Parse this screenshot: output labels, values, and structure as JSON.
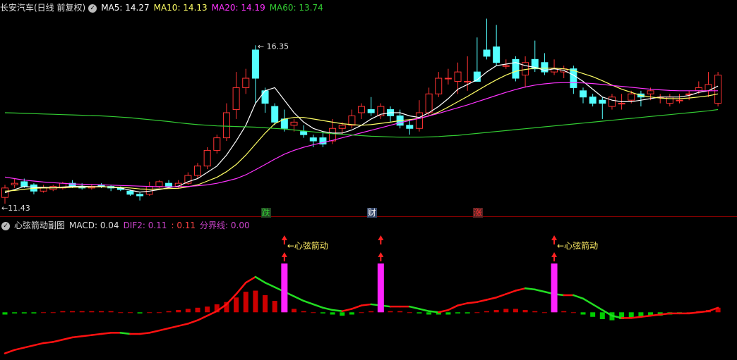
{
  "header": {
    "title": "长安汽车(日线 前复权)",
    "ma": [
      {
        "label": "MA5: 14.27",
        "color": "#ffffff"
      },
      {
        "label": "MA10: 14.13",
        "color": "#ffff66"
      },
      {
        "label": "MA20: 14.19",
        "color": "#ff33ff"
      },
      {
        "label": "MA60: 13.74",
        "color": "#33cc33"
      }
    ]
  },
  "sub_header": {
    "title": "心弦箭动副图",
    "items": [
      {
        "label": "MACD: 0.04",
        "color": "#dddddd"
      },
      {
        "label": "DIF2: 0.11",
        "color": "#cc44cc"
      },
      {
        "label": ": 0.11",
        "color": "#ff4444"
      },
      {
        "label": "分界线: 0.00",
        "color": "#cc44cc"
      }
    ]
  },
  "price_labels": {
    "high": "16.35",
    "low": "11.43"
  },
  "tags": [
    {
      "text": "跌",
      "index": 27,
      "color": "#33cc33"
    },
    {
      "text": "财",
      "index": 38,
      "color": "#ffffff"
    },
    {
      "text": "涨",
      "index": 49,
      "color": "#ff3333"
    }
  ],
  "signal_label": "←心弦箭动",
  "chart_data": [
    {
      "type": "candlestick",
      "title": "长安汽车(日线 前复权)",
      "ylim": [
        11.1,
        17.3
      ],
      "candles": [
        [
          11.5,
          11.8,
          11.9,
          11.3
        ],
        [
          11.9,
          11.95,
          12.1,
          11.8
        ],
        [
          12.0,
          11.85,
          12.1,
          11.8
        ],
        [
          11.9,
          11.7,
          11.95,
          11.6
        ],
        [
          11.7,
          11.8,
          11.9,
          11.65
        ],
        [
          11.75,
          11.85,
          11.9,
          11.7
        ],
        [
          11.8,
          11.95,
          12.0,
          11.75
        ],
        [
          11.95,
          11.85,
          12.05,
          11.8
        ],
        [
          11.85,
          11.8,
          11.95,
          11.75
        ],
        [
          11.8,
          11.85,
          11.9,
          11.75
        ],
        [
          11.9,
          11.85,
          11.95,
          11.8
        ],
        [
          11.85,
          11.8,
          11.9,
          11.7
        ],
        [
          11.8,
          11.75,
          11.85,
          11.7
        ],
        [
          11.7,
          11.6,
          11.75,
          11.55
        ],
        [
          11.6,
          11.55,
          11.65,
          11.4
        ],
        [
          11.6,
          11.85,
          12.0,
          11.55
        ],
        [
          11.85,
          12.0,
          12.05,
          11.8
        ],
        [
          11.95,
          11.85,
          12.05,
          11.8
        ],
        [
          11.85,
          11.95,
          12.05,
          11.8
        ],
        [
          11.95,
          12.2,
          12.3,
          11.9
        ],
        [
          12.2,
          12.5,
          12.6,
          12.1
        ],
        [
          12.5,
          13.0,
          13.1,
          12.4
        ],
        [
          13.0,
          13.4,
          13.5,
          12.9
        ],
        [
          13.4,
          14.2,
          14.5,
          13.3
        ],
        [
          14.3,
          15.0,
          15.5,
          14.0
        ],
        [
          15.0,
          15.3,
          15.6,
          14.8
        ],
        [
          16.2,
          15.3,
          16.35,
          14.5
        ],
        [
          14.9,
          14.5,
          15.0,
          14.2
        ],
        [
          14.4,
          13.9,
          14.5,
          13.8
        ],
        [
          14.0,
          13.7,
          14.3,
          13.6
        ],
        [
          13.8,
          13.9,
          14.0,
          13.6
        ],
        [
          13.6,
          13.5,
          13.8,
          13.4
        ],
        [
          13.4,
          13.3,
          13.5,
          13.1
        ],
        [
          13.4,
          13.2,
          13.6,
          13.1
        ],
        [
          13.3,
          13.7,
          14.0,
          13.2
        ],
        [
          13.7,
          13.8,
          13.9,
          13.5
        ],
        [
          13.8,
          14.1,
          14.3,
          13.7
        ],
        [
          14.2,
          14.4,
          14.5,
          14.0
        ],
        [
          14.3,
          14.2,
          14.7,
          14.1
        ],
        [
          14.1,
          14.4,
          14.5,
          14.0
        ],
        [
          14.3,
          14.1,
          14.4,
          13.9
        ],
        [
          14.1,
          13.8,
          14.3,
          13.7
        ],
        [
          13.8,
          13.7,
          14.0,
          13.5
        ],
        [
          13.7,
          14.2,
          14.6,
          13.6
        ],
        [
          14.2,
          14.8,
          15.0,
          14.1
        ],
        [
          14.8,
          15.3,
          15.5,
          14.7
        ],
        [
          15.3,
          15.3,
          15.6,
          15.1
        ],
        [
          15.2,
          15.5,
          15.8,
          14.8
        ],
        [
          15.2,
          15.2,
          16.0,
          14.9
        ],
        [
          15.5,
          15.2,
          16.6,
          15.3
        ],
        [
          16.2,
          16.0,
          17.2,
          15.9
        ],
        [
          16.3,
          15.8,
          17.0,
          15.7
        ],
        [
          15.7,
          15.7,
          15.9,
          15.6
        ],
        [
          15.9,
          15.3,
          16.0,
          15.2
        ],
        [
          15.4,
          15.8,
          16.0,
          15.0
        ],
        [
          15.9,
          15.6,
          16.5,
          15.5
        ],
        [
          15.8,
          15.5,
          16.1,
          15.4
        ],
        [
          15.5,
          15.6,
          15.9,
          15.4
        ],
        [
          15.5,
          15.6,
          15.7,
          15.3
        ],
        [
          15.6,
          15.0,
          15.7,
          14.8
        ],
        [
          14.9,
          14.7,
          15.0,
          14.5
        ],
        [
          14.7,
          14.5,
          14.8,
          14.4
        ],
        [
          14.6,
          14.5,
          14.7,
          14.0
        ],
        [
          14.4,
          14.7,
          14.8,
          14.3
        ],
        [
          14.5,
          14.5,
          14.8,
          14.3
        ],
        [
          14.6,
          14.8,
          14.9,
          14.5
        ],
        [
          14.8,
          14.7,
          14.9,
          14.4
        ],
        [
          14.8,
          14.9,
          15.0,
          14.6
        ],
        [
          14.7,
          14.7,
          14.8,
          14.5
        ],
        [
          14.5,
          14.7,
          14.8,
          14.4
        ],
        [
          14.6,
          14.6,
          14.8,
          14.5
        ],
        [
          14.8,
          14.8,
          14.9,
          14.6
        ],
        [
          14.9,
          15.0,
          15.2,
          14.8
        ],
        [
          14.9,
          15.1,
          15.5,
          14.7
        ],
        [
          14.5,
          15.4,
          15.5,
          14.4
        ]
      ],
      "series": [
        {
          "name": "MA5",
          "color": "#ffffff",
          "values": [
            11.65,
            11.75,
            11.85,
            11.82,
            11.82,
            11.81,
            11.83,
            11.85,
            11.86,
            11.84,
            11.85,
            11.82,
            11.8,
            11.73,
            11.67,
            11.7,
            11.75,
            11.81,
            11.86,
            12.0,
            12.1,
            12.3,
            12.5,
            12.85,
            13.3,
            13.8,
            14.5,
            14.9,
            15.0,
            14.6,
            14.2,
            13.9,
            13.7,
            13.6,
            13.55,
            13.55,
            13.65,
            13.8,
            14.0,
            14.15,
            14.2,
            14.2,
            14.1,
            14.05,
            14.2,
            14.4,
            14.65,
            14.95,
            15.1,
            15.25,
            15.5,
            15.7,
            15.75,
            15.8,
            15.7,
            15.65,
            15.55,
            15.6,
            15.55,
            15.4,
            15.2,
            14.95,
            14.7,
            14.6,
            14.55,
            14.55,
            14.6,
            14.65,
            14.7,
            14.7,
            14.7,
            14.75,
            14.85,
            14.9,
            15.05
          ]
        },
        {
          "name": "MA10",
          "color": "#ffff66",
          "values": [
            11.7,
            11.72,
            11.76,
            11.79,
            11.8,
            11.8,
            11.81,
            11.82,
            11.83,
            11.83,
            11.84,
            11.83,
            11.82,
            11.8,
            11.77,
            11.76,
            11.77,
            11.78,
            11.79,
            11.84,
            11.9,
            12.02,
            12.14,
            12.32,
            12.55,
            12.85,
            13.2,
            13.55,
            13.85,
            14.0,
            14.05,
            14.05,
            14.0,
            13.95,
            13.9,
            13.85,
            13.82,
            13.8,
            13.82,
            13.86,
            13.9,
            13.95,
            13.98,
            14.02,
            14.1,
            14.22,
            14.38,
            14.55,
            14.72,
            14.9,
            15.08,
            15.25,
            15.4,
            15.52,
            15.58,
            15.62,
            15.62,
            15.62,
            15.6,
            15.55,
            15.45,
            15.35,
            15.22,
            15.08,
            14.95,
            14.85,
            14.75,
            14.7,
            14.67,
            14.65,
            14.65,
            14.67,
            14.7,
            14.74,
            14.8
          ]
        },
        {
          "name": "MA20",
          "color": "#ff33ff",
          "values": [
            12.15,
            12.1,
            12.05,
            12.02,
            11.99,
            11.97,
            11.95,
            11.93,
            11.92,
            11.91,
            11.9,
            11.89,
            11.88,
            11.87,
            11.86,
            11.85,
            11.84,
            11.84,
            11.84,
            11.85,
            11.87,
            11.9,
            11.95,
            12.02,
            12.1,
            12.22,
            12.38,
            12.55,
            12.72,
            12.88,
            13.0,
            13.1,
            13.18,
            13.25,
            13.32,
            13.4,
            13.48,
            13.56,
            13.64,
            13.72,
            13.8,
            13.88,
            13.95,
            14.02,
            14.1,
            14.18,
            14.27,
            14.36,
            14.45,
            14.55,
            14.65,
            14.75,
            14.85,
            14.94,
            15.02,
            15.08,
            15.12,
            15.15,
            15.16,
            15.16,
            15.15,
            15.13,
            15.1,
            15.07,
            15.04,
            15.01,
            14.98,
            14.95,
            14.93,
            14.91,
            14.9,
            14.9,
            14.9,
            14.9,
            14.9
          ]
        },
        {
          "name": "MA60",
          "color": "#33cc33",
          "values": [
            14.2,
            14.19,
            14.18,
            14.17,
            14.16,
            14.15,
            14.14,
            14.13,
            14.12,
            14.11,
            14.1,
            14.08,
            14.06,
            14.04,
            14.01,
            13.98,
            13.95,
            13.92,
            13.88,
            13.85,
            13.82,
            13.8,
            13.78,
            13.77,
            13.76,
            13.75,
            13.74,
            13.72,
            13.7,
            13.68,
            13.65,
            13.62,
            13.59,
            13.56,
            13.53,
            13.51,
            13.49,
            13.47,
            13.45,
            13.44,
            13.43,
            13.42,
            13.42,
            13.42,
            13.43,
            13.44,
            13.46,
            13.48,
            13.51,
            13.54,
            13.57,
            13.6,
            13.63,
            13.66,
            13.69,
            13.72,
            13.75,
            13.78,
            13.81,
            13.84,
            13.87,
            13.9,
            13.93,
            13.96,
            13.99,
            14.02,
            14.05,
            14.08,
            14.11,
            14.14,
            14.17,
            14.2,
            14.23,
            14.26,
            14.3
          ]
        }
      ]
    },
    {
      "type": "bar",
      "title": "心弦箭动副图",
      "ylim": [
        -0.4,
        0.7
      ],
      "series": [
        {
          "name": "MACD",
          "values": [
            -0.02,
            -0.01,
            -0.01,
            -0.01,
            0.0,
            0.0,
            0.01,
            0.01,
            0.01,
            0.01,
            0.01,
            0.01,
            0.0,
            0.0,
            -0.01,
            0.0,
            0.0,
            0.01,
            0.02,
            0.03,
            0.04,
            0.05,
            0.07,
            0.09,
            0.13,
            0.18,
            0.19,
            0.15,
            0.1,
            0.06,
            0.03,
            0.01,
            0.0,
            -0.01,
            -0.02,
            -0.03,
            -0.02,
            0.0,
            0.01,
            0.01,
            0.01,
            0.01,
            0.0,
            -0.01,
            -0.02,
            -0.02,
            -0.02,
            -0.01,
            -0.01,
            0.0,
            0.01,
            0.02,
            0.03,
            0.03,
            0.02,
            0.01,
            0.0,
            0.01,
            0.01,
            0.0,
            -0.02,
            -0.04,
            -0.06,
            -0.07,
            -0.06,
            -0.05,
            -0.04,
            -0.03,
            -0.03,
            -0.02,
            -0.01,
            0.0,
            0.01,
            0.02,
            0.04
          ]
        },
        {
          "name": "DIF2",
          "values": [
            -0.36,
            -0.33,
            -0.31,
            -0.29,
            -0.27,
            -0.26,
            -0.24,
            -0.22,
            -0.21,
            -0.2,
            -0.19,
            -0.18,
            -0.18,
            -0.19,
            -0.19,
            -0.18,
            -0.16,
            -0.14,
            -0.12,
            -0.1,
            -0.07,
            -0.03,
            0.01,
            0.07,
            0.16,
            0.26,
            0.31,
            0.26,
            0.22,
            0.18,
            0.14,
            0.1,
            0.07,
            0.04,
            0.02,
            0.01,
            0.03,
            0.06,
            0.07,
            0.06,
            0.05,
            0.05,
            0.05,
            0.03,
            0.01,
            0.0,
            0.02,
            0.06,
            0.08,
            0.09,
            0.11,
            0.13,
            0.16,
            0.19,
            0.21,
            0.2,
            0.18,
            0.16,
            0.15,
            0.15,
            0.12,
            0.07,
            0.02,
            -0.03,
            -0.05,
            -0.05,
            -0.04,
            -0.03,
            -0.02,
            -0.01,
            -0.01,
            -0.01,
            0.0,
            0.01,
            0.04
          ]
        },
        {
          "name": "分界线",
          "values": [
            0.0
          ]
        }
      ],
      "signals": [
        29,
        39,
        57
      ]
    }
  ]
}
